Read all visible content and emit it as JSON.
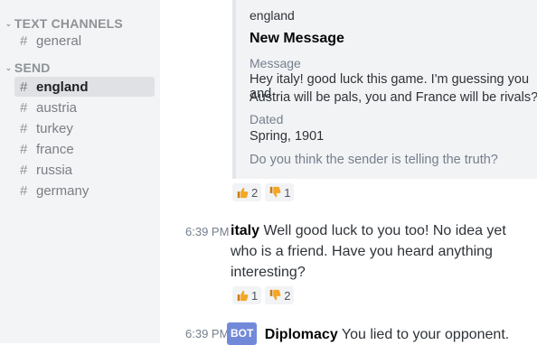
{
  "sidebar": {
    "categories": [
      {
        "label": "TEXT CHANNELS",
        "channels": [
          "general"
        ]
      },
      {
        "label": "SEND",
        "channels": [
          "england",
          "austria",
          "turkey",
          "france",
          "russia",
          "germany"
        ]
      }
    ],
    "selected": "england",
    "hash_glyph": "#"
  },
  "embed": {
    "author": "england",
    "title": "New Message",
    "message_label": "Message",
    "message_line1": "Hey italy! good luck this game. I'm guessing you and",
    "message_line2": "Austria will be pals, you and France will be rivals?",
    "dated_label": "Dated",
    "dated_value": "Spring, 1901",
    "question": "Do you think the sender is telling the truth?"
  },
  "reactions_1": [
    {
      "icon": "thumbs-up-icon",
      "count": "2"
    },
    {
      "icon": "thumbs-down-icon",
      "count": "1"
    }
  ],
  "messages": [
    {
      "time": "6:39 PM",
      "author": "italy",
      "line1": "Well good luck to you too! No idea yet",
      "line2": "who is a friend. Have you heard anything",
      "line3": "interesting?",
      "reactions": [
        {
          "icon": "thumbs-up-icon",
          "count": "1"
        },
        {
          "icon": "thumbs-down-icon",
          "count": "2"
        }
      ]
    },
    {
      "time": "6:39 PM",
      "badge": "BOT",
      "author": "Diplomacy",
      "text": "You lied to your opponent."
    }
  ],
  "colors": {
    "thumbs_up": "#f5a623",
    "thumbs_down": "#f5a623",
    "bot_badge": "#7289da"
  }
}
